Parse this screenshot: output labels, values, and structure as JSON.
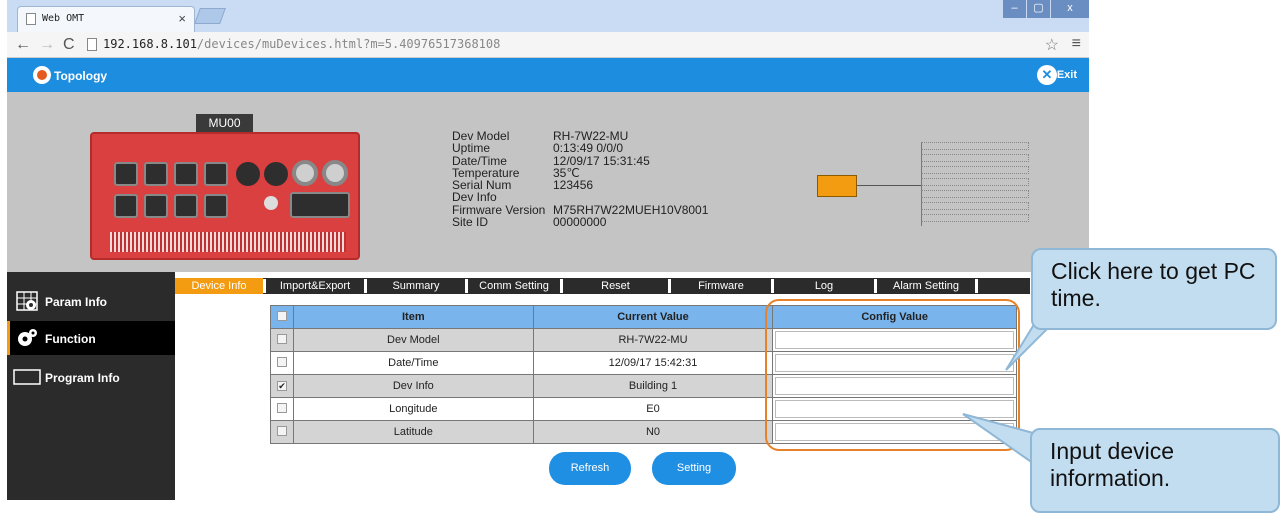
{
  "browser": {
    "tab_title": "Web OMT",
    "tab_close": "×",
    "url_host": "192.168.8.101",
    "url_path": "/devices/muDevices.html?m=5.40976517368108",
    "window_buttons": [
      "–",
      "▢",
      "x"
    ]
  },
  "header": {
    "topology_label": "Topology",
    "exit_label": "Exit"
  },
  "device": {
    "unit_label": "MU00",
    "info": [
      {
        "key": "Dev Model",
        "value": "RH-7W22-MU"
      },
      {
        "key": "Uptime",
        "value": "0:13:49 0/0/0"
      },
      {
        "key": "Date/Time",
        "value": "12/09/17 15:31:45"
      },
      {
        "key": "Temperature",
        "value": "35℃"
      },
      {
        "key": "Serial Num",
        "value": "123456"
      },
      {
        "key": "Dev Info",
        "value": ""
      },
      {
        "key": "Firmware Version",
        "value": "M75RH7W22MUEH10V8001"
      },
      {
        "key": "Site ID",
        "value": "00000000"
      }
    ]
  },
  "sidebar": {
    "items": [
      {
        "label": "Param Info",
        "icon": "grid-gear-icon",
        "active": false
      },
      {
        "label": "Function",
        "icon": "gear-icon",
        "active": true
      },
      {
        "label": "Program Info",
        "icon": "monitor-icon",
        "active": false
      }
    ]
  },
  "tabs": [
    "Device Info",
    "Import&Export",
    "Summary",
    "Comm Setting",
    "Reset",
    "Firmware",
    "Log",
    "Alarm Setting"
  ],
  "table": {
    "headers": [
      "Item",
      "Current Value",
      "Config Value"
    ],
    "rows": [
      {
        "item": "Dev Model",
        "current": "RH-7W22-MU",
        "config": "",
        "checked": false
      },
      {
        "item": "Date/Time",
        "current": "12/09/17 15:42:31",
        "config": "",
        "checked": false
      },
      {
        "item": "Dev Info",
        "current": "Building 1",
        "config": "",
        "checked": true
      },
      {
        "item": "Longitude",
        "current": "E0",
        "config": "",
        "checked": false
      },
      {
        "item": "Latitude",
        "current": "N0",
        "config": "",
        "checked": false
      }
    ]
  },
  "buttons": {
    "refresh": "Refresh",
    "setting": "Setting"
  },
  "callouts": {
    "pc_time": "Click here to get PC time.",
    "device_info": "Input device information."
  },
  "colors": {
    "accent_blue": "#1d8de0",
    "active_orange": "#f39c12",
    "highlight_orange": "#e5822a"
  }
}
